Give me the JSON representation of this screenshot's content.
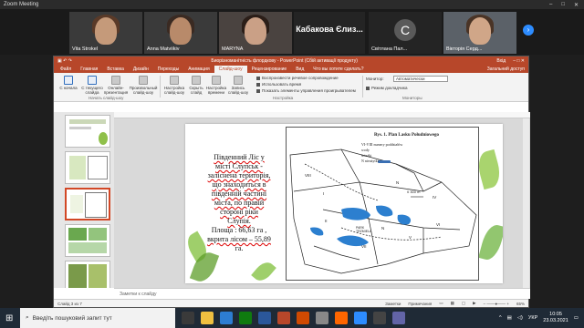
{
  "zoom": {
    "title": "Zoom Meeting",
    "participants": [
      {
        "name": "Vita Strokel"
      },
      {
        "name": "Anna Matviikiv"
      },
      {
        "name": "MARYNA"
      },
      {
        "name": "Кабакова Єлиз..."
      },
      {
        "name": "Світлана Пал...",
        "initial": "C"
      },
      {
        "name": "Вікторія Серд..."
      }
    ],
    "next_arrow": "›"
  },
  "ppt": {
    "title": "Биорізноманітність флордкову - PowerPoint (Сбій активації продукту)",
    "signin": "Вхід",
    "share": "Загальний доступ",
    "tabs": [
      "Файл",
      "Главная",
      "Вставка",
      "Дизайн",
      "Переходы",
      "Анимация",
      "Слайд-шоу",
      "Рецензирование",
      "Вид",
      "Что вы хотите сделать?"
    ],
    "active_tab": "Слайд-шоу",
    "ribbon": {
      "buttons": [
        "С начала",
        "С текущего слайда",
        "Онлайн-презентация",
        "Произвольный слайд-шоу",
        "Настройка слайд-шоу",
        "Скрыть слайд",
        "Настройка времени",
        "Запись слайд-шоу"
      ],
      "group_start": "Начать слайд-шоу",
      "group_setup": "Настройка",
      "group_monitors": "Мониторы",
      "checks": [
        "Воспроизвести речевое сопровождение",
        "Использовать время",
        "Показать элементы управления проигрывателем"
      ],
      "monitor_label": "Монитор:",
      "monitor_value": "Автоматически",
      "presenter_view": "Режим докладчика"
    },
    "slide_text": {
      "l1": "Південний Ліс у",
      "l2": "місті Слупськ -",
      "l3": "заліснена територія,",
      "l4": "що знаходиться в",
      "l5": "південній частині",
      "l6": "міста, по правій",
      "l7": "стороні ріки",
      "l8": "Слупія.",
      "l9": "Площа : 66,63 га ,",
      "l10": "вкрита лісом – 55,89",
      "l11": "га."
    },
    "map": {
      "title": "Rys. 1. Plan Lasku Południowego",
      "legend": [
        {
          "code": "VI-VIII",
          "label": "numery poddziałów"
        },
        {
          "code": "",
          "label": "wody"
        },
        {
          "code": "",
          "label": "ścieżki"
        },
        {
          "code": "N",
          "label": "nieużytki"
        }
      ],
      "labels": [
        "VIII",
        "VII",
        "VI",
        "V",
        "IV",
        "I",
        "II",
        "N",
        "N",
        "PARK TRZMIELA"
      ],
      "scale": "0       300 m"
    },
    "notes_placeholder": "Заметки к слайду",
    "status": {
      "slide": "Слайд 3 из 7",
      "notes": "Заметки",
      "comments": "Примечания",
      "zoom": "65%"
    }
  },
  "taskbar": {
    "search_placeholder": "Введіть пошуковий запит тут",
    "lang": "УКР",
    "time": "10:05",
    "date": "23.03.2021"
  }
}
